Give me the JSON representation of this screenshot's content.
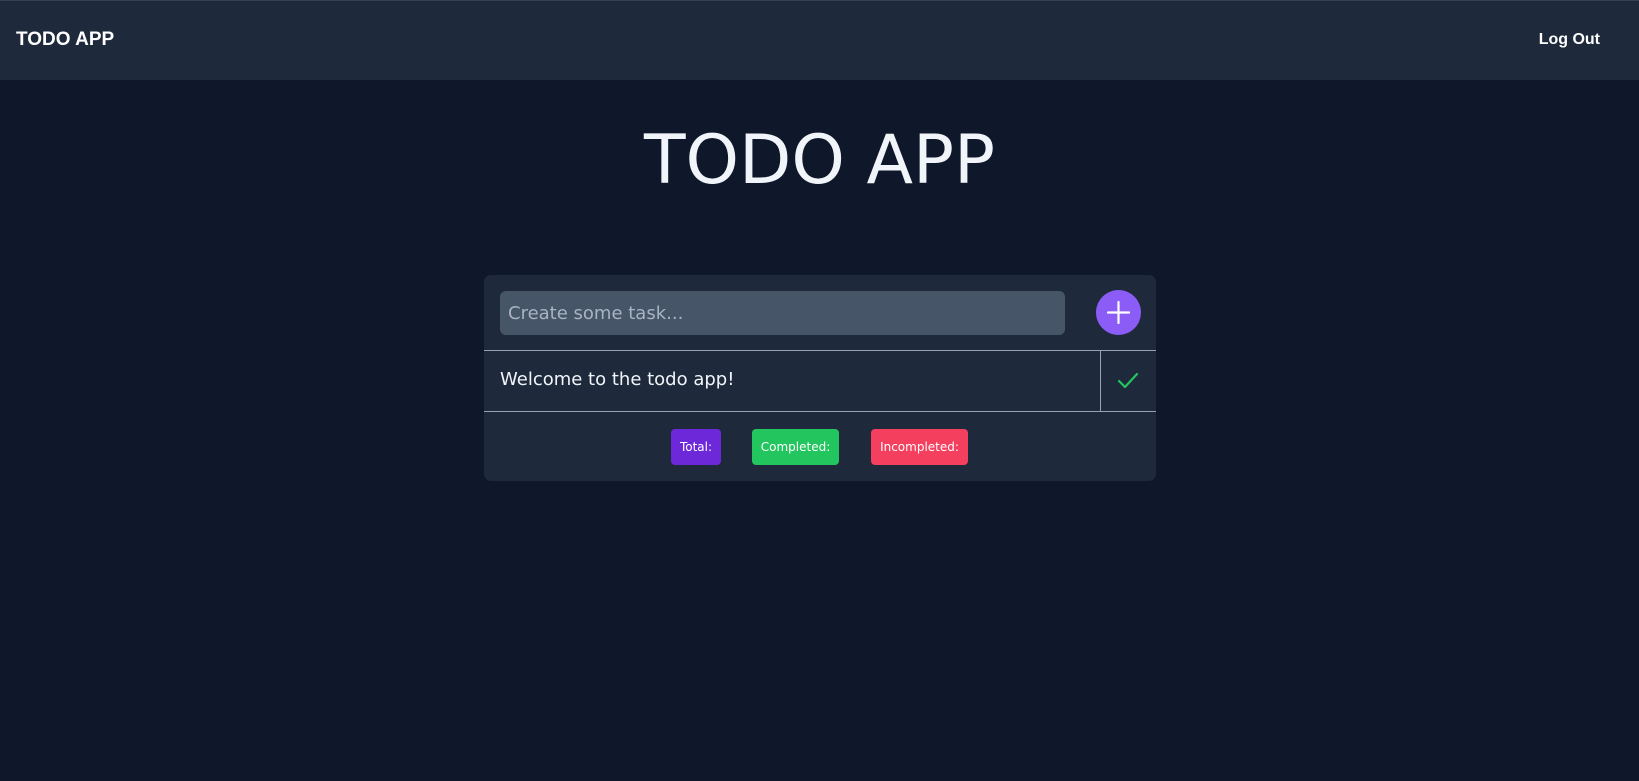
{
  "navbar": {
    "brand": "TODO APP",
    "logout_label": "Log Out"
  },
  "main": {
    "title": "TODO APP"
  },
  "task_form": {
    "placeholder": "Create some task...",
    "value": "",
    "add_icon": "plus-icon"
  },
  "todos": [
    {
      "text": "Welcome to the todo app!",
      "status_icon": "check-icon"
    }
  ],
  "stats": {
    "total_label": "Total:",
    "completed_label": "Completed:",
    "incompleted_label": "Incompleted:"
  },
  "colors": {
    "background": "#0f172a",
    "surface": "#1e293b",
    "input": "#475569",
    "accent": "#8b5cf6",
    "total": "#6d28d9",
    "completed": "#22c55e",
    "incompleted": "#f43f5e"
  }
}
